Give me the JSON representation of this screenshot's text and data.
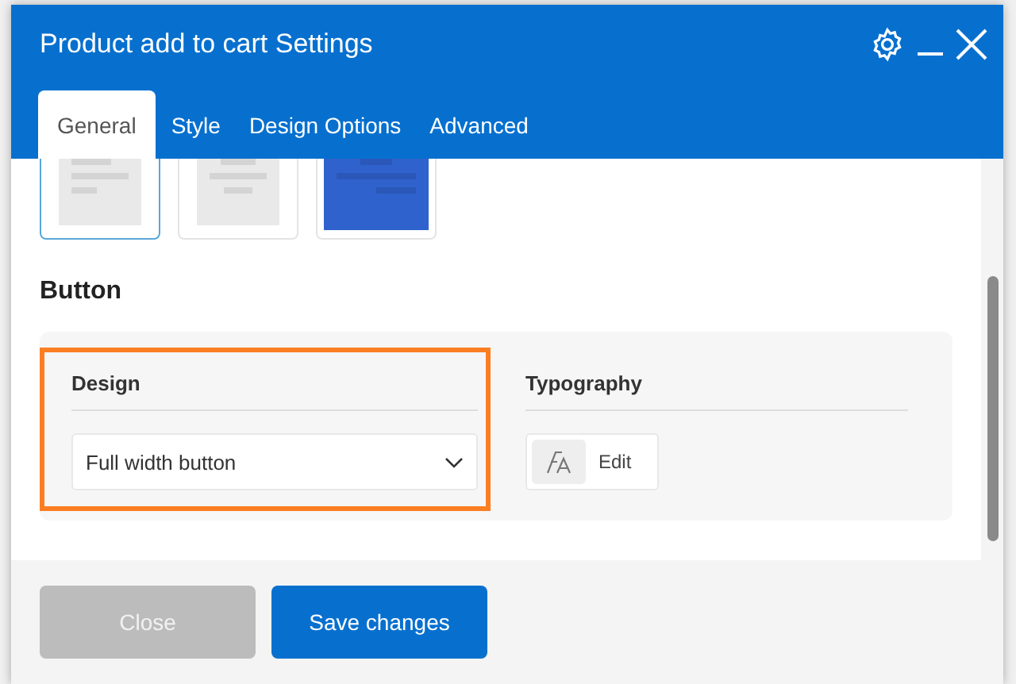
{
  "window": {
    "title": "Product add to cart Settings"
  },
  "tabs": [
    {
      "label": "General",
      "selected": true
    },
    {
      "label": "Style",
      "selected": false
    },
    {
      "label": "Design Options",
      "selected": false
    },
    {
      "label": "Advanced",
      "selected": false
    }
  ],
  "layouts": [
    {
      "kind": "left",
      "selected": true
    },
    {
      "kind": "center",
      "selected": false
    },
    {
      "kind": "filled",
      "selected": false
    }
  ],
  "section": {
    "title": "Button",
    "design": {
      "label": "Design",
      "value": "Full width button",
      "highlighted": true
    },
    "typography": {
      "label": "Typography",
      "button": "Edit"
    }
  },
  "buttons": [
    {
      "label": "Close",
      "kind": "secondary",
      "disabled": true
    },
    {
      "label": "Save changes",
      "kind": "primary",
      "disabled": false
    }
  ]
}
